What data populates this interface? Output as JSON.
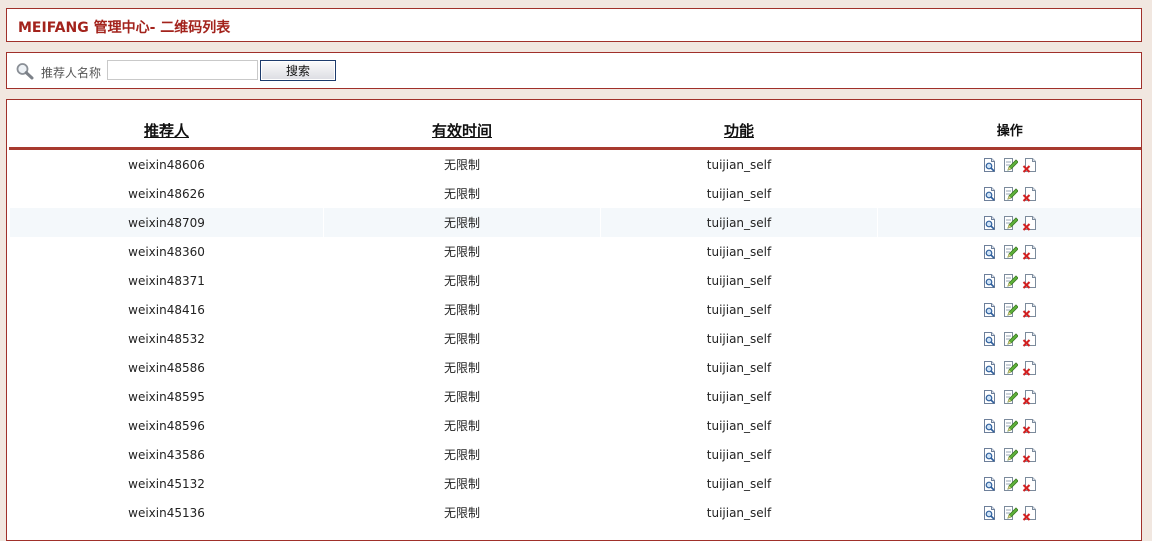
{
  "header": {
    "title": "MEIFANG 管理中心- 二维码列表"
  },
  "search": {
    "label": "推荐人名称",
    "value": "",
    "button_label": "搜索"
  },
  "table": {
    "columns": [
      "推荐人",
      "有效时间",
      "功能",
      "操作"
    ],
    "rows": [
      {
        "referrer": "weixin48606",
        "valid_time": "无限制",
        "function": "tuijian_self"
      },
      {
        "referrer": "weixin48626",
        "valid_time": "无限制",
        "function": "tuijian_self"
      },
      {
        "referrer": "weixin48709",
        "valid_time": "无限制",
        "function": "tuijian_self"
      },
      {
        "referrer": "weixin48360",
        "valid_time": "无限制",
        "function": "tuijian_self"
      },
      {
        "referrer": "weixin48371",
        "valid_time": "无限制",
        "function": "tuijian_self"
      },
      {
        "referrer": "weixin48416",
        "valid_time": "无限制",
        "function": "tuijian_self"
      },
      {
        "referrer": "weixin48532",
        "valid_time": "无限制",
        "function": "tuijian_self"
      },
      {
        "referrer": "weixin48586",
        "valid_time": "无限制",
        "function": "tuijian_self"
      },
      {
        "referrer": "weixin48595",
        "valid_time": "无限制",
        "function": "tuijian_self"
      },
      {
        "referrer": "weixin48596",
        "valid_time": "无限制",
        "function": "tuijian_self"
      },
      {
        "referrer": "weixin43586",
        "valid_time": "无限制",
        "function": "tuijian_self"
      },
      {
        "referrer": "weixin45132",
        "valid_time": "无限制",
        "function": "tuijian_self"
      },
      {
        "referrer": "weixin45136",
        "valid_time": "无限制",
        "function": "tuijian_self"
      }
    ],
    "row_actions": [
      "view-icon",
      "edit-icon",
      "delete-icon"
    ]
  },
  "colors": {
    "page_background": "#f1e7e0",
    "panel_border": "#a0302a",
    "title_text": "#a3231c",
    "header_rule": "#a73a2e",
    "highlight_row": "#f4f8fb"
  }
}
